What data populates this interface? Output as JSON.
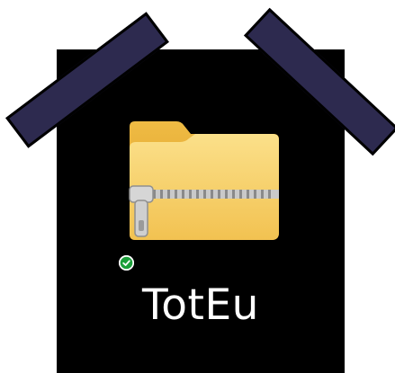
{
  "desktop_item": {
    "name": "TotEu",
    "icon": "zip-folder-icon",
    "sync_status_icon": "synced-check-icon"
  },
  "colors": {
    "background": "#000000",
    "tape": "#2d2a4f",
    "folder_back": "#e7b23c",
    "folder_front": "#f7d36b",
    "zipper": "#b7b7b7",
    "status_green": "#1b9f3a"
  }
}
